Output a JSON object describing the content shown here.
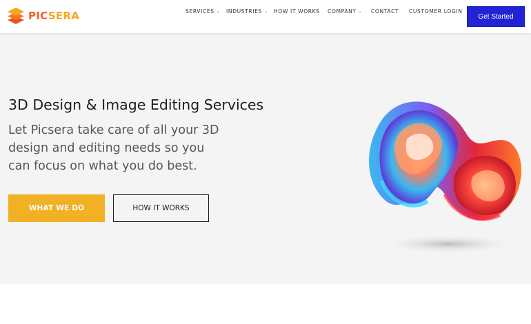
{
  "brand": {
    "logo_part1": "PIC",
    "logo_part2": "SERA",
    "logo_icon": "stacked-layers-icon"
  },
  "nav": {
    "items": [
      {
        "label": "SERVICES",
        "has_dropdown": true
      },
      {
        "label": "INDUSTRIES",
        "has_dropdown": true
      },
      {
        "label": "HOW IT WORKS",
        "has_dropdown": false
      },
      {
        "label": "COMPANY",
        "has_dropdown": true
      },
      {
        "label": "CONTACT",
        "has_dropdown": false
      },
      {
        "label": "CUSTOMER LOGIN",
        "has_dropdown": false
      }
    ],
    "dropdown_icon": "chevron-down-icon",
    "cta_label": "Get Started"
  },
  "hero": {
    "title": "3D Design & Image Editing Services",
    "subtitle": "Let Picsera take care of all your 3D design and editing needs so you can focus on what you do best.",
    "primary_button": "WHAT WE DO",
    "secondary_button": "HOW IT WORKS",
    "illustration": "abstract-3d-twisted-ribbon"
  },
  "colors": {
    "brand_orange": "#f0602a",
    "brand_yellow": "#f5a623",
    "cta_blue": "#2323d6",
    "primary_button": "#f2b025",
    "hero_bg": "#f4f4f4"
  }
}
